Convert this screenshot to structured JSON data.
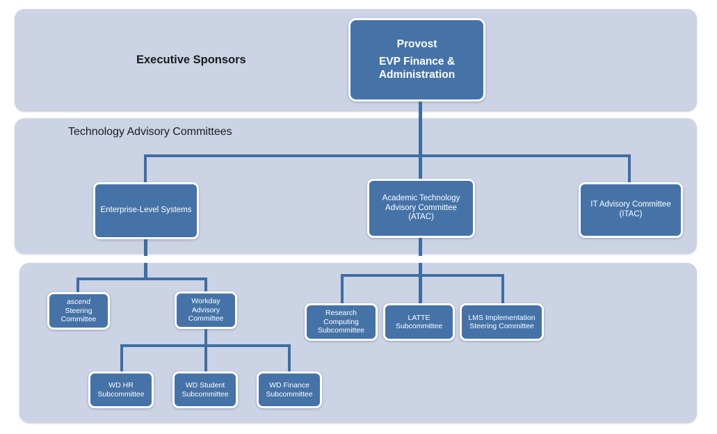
{
  "diagram": {
    "title": "Technology Governance Organizational Chart",
    "colors": {
      "panel_background": "#ccd3e4",
      "node_fill": "#4573a8",
      "node_border": "#ffffff",
      "connector": "#3d6ea5",
      "page_background": "#ffffff",
      "panel_label_text": "#1a1a1a",
      "node_text": "#ffffff"
    }
  },
  "panels": [
    {
      "id": "executive-sponsors",
      "label": "Executive Sponsors",
      "style": "bold"
    },
    {
      "id": "technology-advisory-committees",
      "label": "Technology Advisory Committees",
      "style": "plain"
    },
    {
      "id": "subcommittees",
      "label": "",
      "style": "plain"
    }
  ],
  "nodes": {
    "provost": {
      "id": "provost",
      "level": 1,
      "lines": [
        "Provost",
        "EVP Finance &",
        "Administration"
      ]
    },
    "enterprise_level_systems": {
      "id": "enterprise-level-systems",
      "level": 2,
      "lines": [
        "Enterprise-Level Systems"
      ]
    },
    "atac": {
      "id": "academic-technology-advisory-committee",
      "level": 2,
      "lines": [
        "Academic Technology",
        "Advisory Committee (ATAC)"
      ]
    },
    "itac": {
      "id": "it-advisory-committee",
      "level": 2,
      "lines": [
        "IT Advisory Committee",
        "(ITAC)"
      ]
    },
    "ascend": {
      "id": "ascend-steering-committee",
      "level": 3,
      "lines": [
        "ascend",
        "Steering",
        "Committee"
      ],
      "italic_first_line": true
    },
    "workday": {
      "id": "workday-advisory-committee",
      "level": 3,
      "lines": [
        "Workday",
        "Advisory",
        "Committee"
      ]
    },
    "research_computing": {
      "id": "research-computing-subcommittee",
      "level": 3,
      "lines": [
        "Research",
        "Computing",
        "Subcommittee"
      ]
    },
    "latte": {
      "id": "latte-subcommittee",
      "level": 3,
      "lines": [
        "LATTE",
        "Subcommittee"
      ]
    },
    "lms": {
      "id": "lms-implementation-steering-committee",
      "level": 3,
      "lines": [
        "LMS Implementation",
        "Steering Committee"
      ]
    },
    "wd_hr": {
      "id": "wd-hr-subcommittee",
      "level": 4,
      "lines": [
        "WD HR",
        "Subcommittee"
      ]
    },
    "wd_student": {
      "id": "wd-student-subcommittee",
      "level": 4,
      "lines": [
        "WD Student",
        "Subcommittee"
      ]
    },
    "wd_finance": {
      "id": "wd-finance-subcommittee",
      "level": 4,
      "lines": [
        "WD Finance",
        "Subcommittee"
      ]
    }
  },
  "hierarchy": {
    "root": "provost",
    "edges": [
      {
        "from": "provost",
        "to": "enterprise_level_systems"
      },
      {
        "from": "provost",
        "to": "atac"
      },
      {
        "from": "provost",
        "to": "itac"
      },
      {
        "from": "enterprise_level_systems",
        "to": "ascend"
      },
      {
        "from": "enterprise_level_systems",
        "to": "workday"
      },
      {
        "from": "workday",
        "to": "wd_hr"
      },
      {
        "from": "workday",
        "to": "wd_student"
      },
      {
        "from": "workday",
        "to": "wd_finance"
      },
      {
        "from": "atac",
        "to": "research_computing"
      },
      {
        "from": "atac",
        "to": "latte"
      },
      {
        "from": "atac",
        "to": "lms"
      }
    ]
  }
}
